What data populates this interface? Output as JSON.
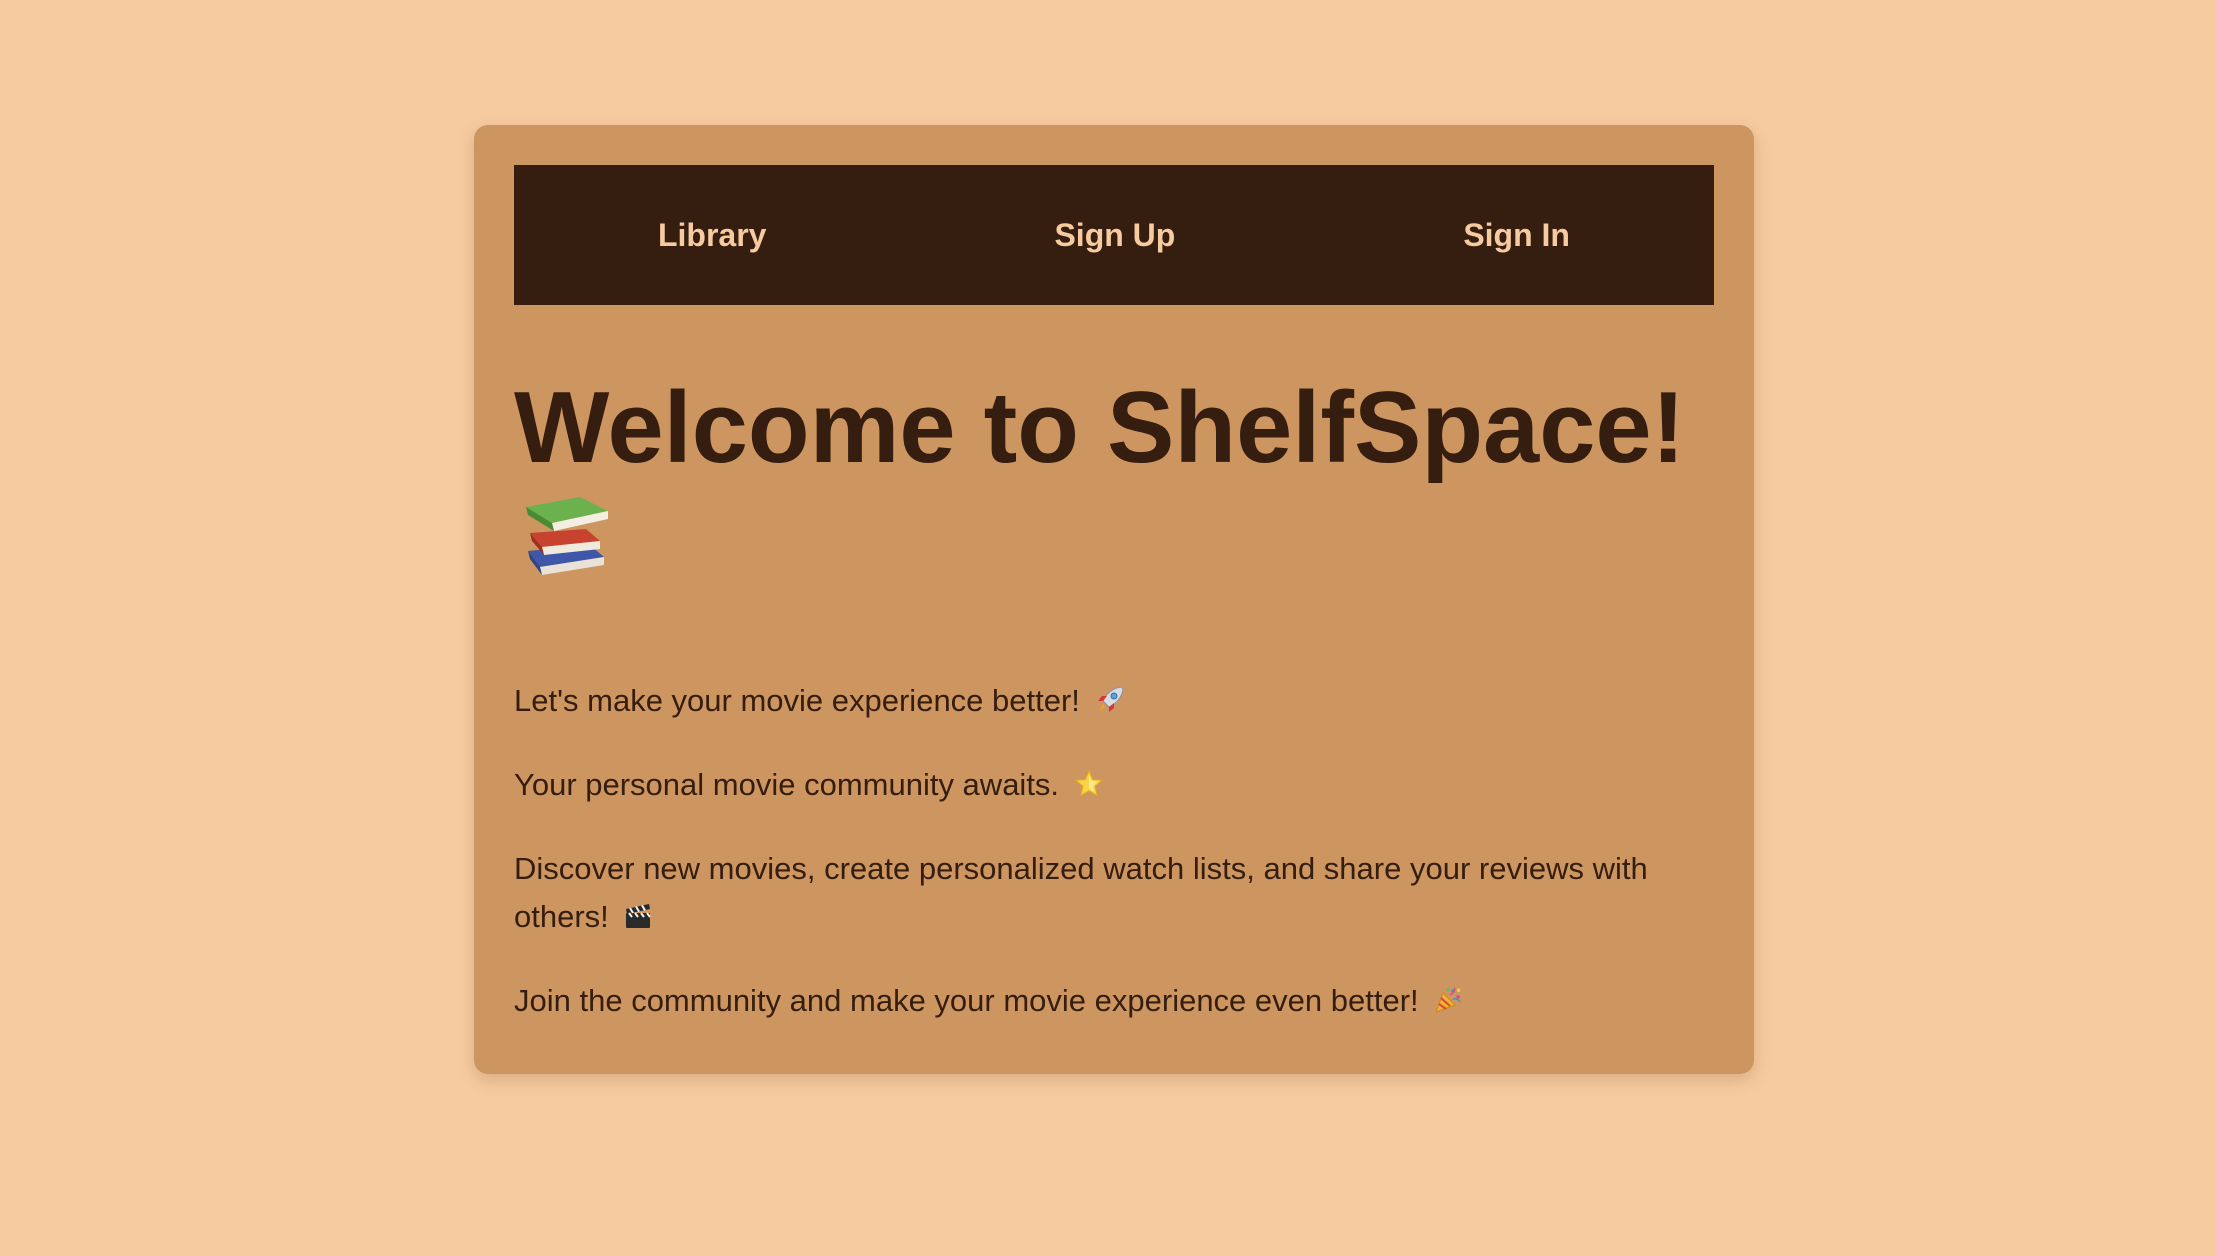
{
  "nav": {
    "library_label": "Library",
    "signup_label": "Sign Up",
    "signin_label": "Sign In"
  },
  "hero": {
    "title": "Welcome to ShelfSpace!",
    "icon": "books-icon"
  },
  "paragraphs": [
    {
      "text": "Let's make your movie experience better!",
      "icon": "rocket-icon"
    },
    {
      "text": "Your personal movie community awaits.",
      "icon": "star-icon"
    },
    {
      "text": "Discover new movies, create personalized watch lists, and share your reviews with others!",
      "icon": "clapperboard-icon"
    },
    {
      "text": "Join the community and make your movie experience even better!",
      "icon": "party-popper-icon"
    }
  ],
  "colors": {
    "page_background": "#f6cb9f",
    "card_background": "#cd9660",
    "navbar_background": "#351d10",
    "nav_text": "#f6cb9f",
    "body_text": "#351d10"
  }
}
